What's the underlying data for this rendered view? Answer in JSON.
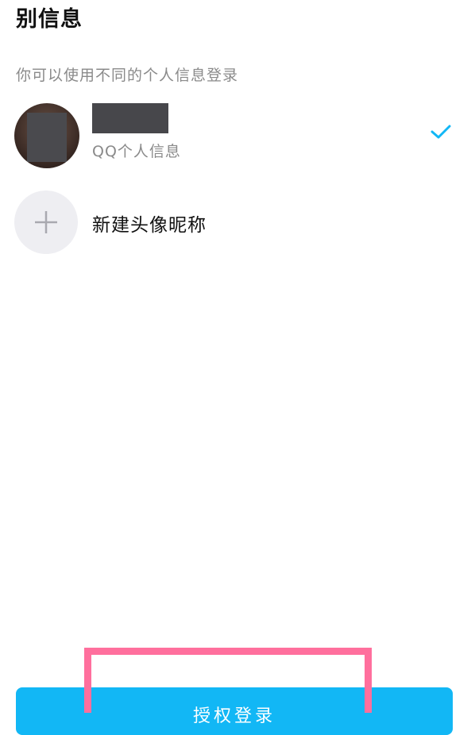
{
  "header": {
    "title": "别信息",
    "subtitle": "你可以使用不同的个人信息登录"
  },
  "accounts": [
    {
      "name": "",
      "description": "QQ个人信息",
      "selected": true,
      "avatar_icon": "user-avatar",
      "check_icon": "check-icon"
    }
  ],
  "new_profile": {
    "label": "新建头像昵称",
    "icon": "plus-icon"
  },
  "footer": {
    "authorize_label": "授权登录"
  },
  "colors": {
    "accent": "#12b7f5",
    "check": "#12b7f5",
    "highlight": "#ff6f9d",
    "muted_text": "#8a8a8a",
    "plus_bg": "#eeeef2"
  }
}
